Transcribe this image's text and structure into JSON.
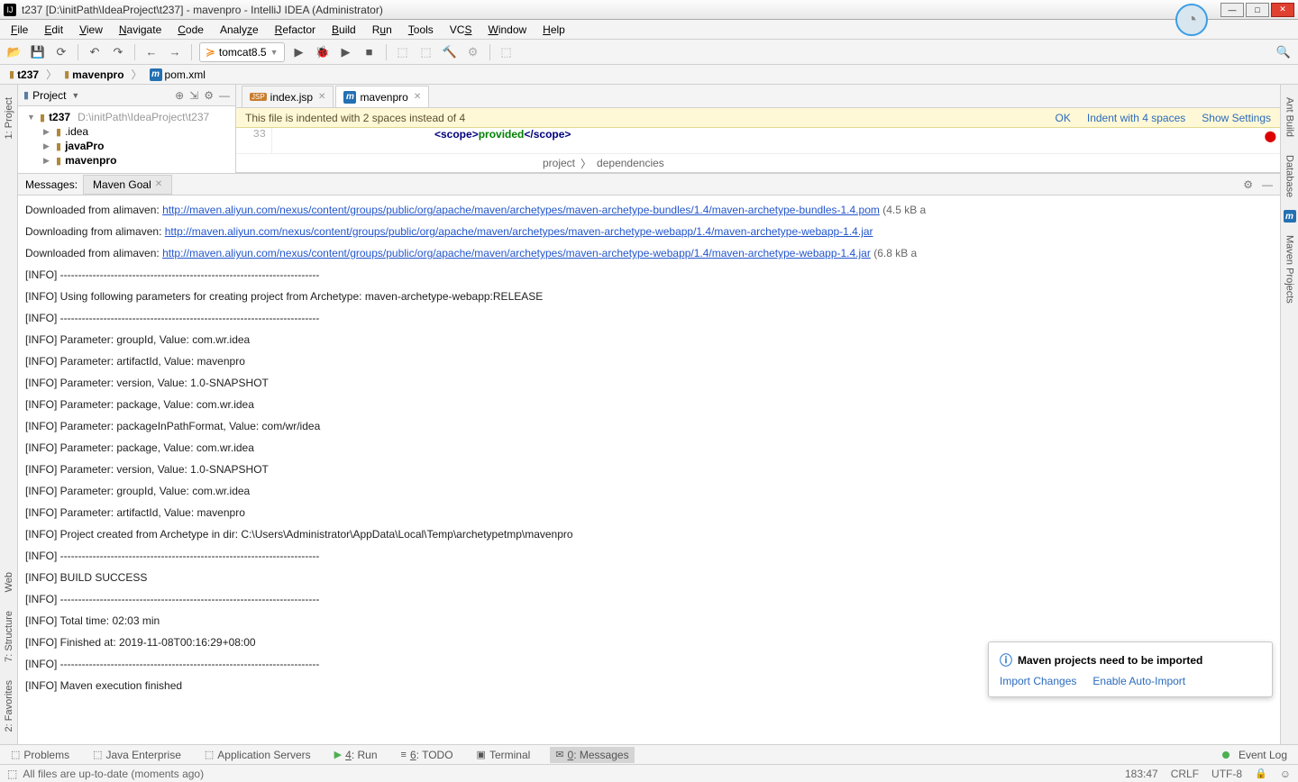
{
  "window": {
    "title": "t237 [D:\\initPath\\IdeaProject\\t237] - mavenpro - IntelliJ IDEA (Administrator)"
  },
  "menu": [
    "File",
    "Edit",
    "View",
    "Navigate",
    "Code",
    "Analyze",
    "Refactor",
    "Build",
    "Run",
    "Tools",
    "VCS",
    "Window",
    "Help"
  ],
  "toolbar": {
    "run_config": "tomcat8.5"
  },
  "breadcrumb": {
    "b1": "t237",
    "b2": "mavenpro",
    "b3": "pom.xml"
  },
  "project": {
    "panel_label": "Project",
    "root_name": "t237",
    "root_path": "D:\\initPath\\IdeaProject\\t237",
    "nodes": [
      ".idea",
      "javaPro",
      "mavenpro"
    ]
  },
  "editor_tabs": {
    "tab1": "index.jsp",
    "tab2": "mavenpro"
  },
  "notice": {
    "text": "This file is indented with 2 spaces instead of 4",
    "ok": "OK",
    "indent": "Indent with 4 spaces",
    "settings": "Show Settings"
  },
  "code": {
    "line_no": "33",
    "line_text_open": "<scope>",
    "line_text_mid": "provided",
    "line_text_close": "</scope>"
  },
  "editor_bc": {
    "p1": "project",
    "p2": "dependencies"
  },
  "messages": {
    "label": "Messages:",
    "tab": "Maven Goal",
    "lines": [
      {
        "prefix": "Downloaded from alimaven: ",
        "link": "http://maven.aliyun.com/nexus/content/groups/public/org/apache/maven/archetypes/maven-archetype-bundles/1.4/maven-archetype-bundles-1.4.pom",
        "suffix": " (4.5 kB a"
      },
      {
        "prefix": "Downloading from alimaven: ",
        "link": "http://maven.aliyun.com/nexus/content/groups/public/org/apache/maven/archetypes/maven-archetype-webapp/1.4/maven-archetype-webapp-1.4.jar",
        "suffix": ""
      },
      {
        "prefix": "Downloaded from alimaven: ",
        "link": "http://maven.aliyun.com/nexus/content/groups/public/org/apache/maven/archetypes/maven-archetype-webapp/1.4/maven-archetype-webapp-1.4.jar",
        "suffix": " (6.8 kB a"
      },
      {
        "text": "[INFO] ------------------------------------------------------------------------"
      },
      {
        "text": "[INFO] Using following parameters for creating project from Archetype: maven-archetype-webapp:RELEASE"
      },
      {
        "text": "[INFO] ------------------------------------------------------------------------"
      },
      {
        "text": "[INFO] Parameter: groupId, Value: com.wr.idea"
      },
      {
        "text": "[INFO] Parameter: artifactId, Value: mavenpro"
      },
      {
        "text": "[INFO] Parameter: version, Value: 1.0-SNAPSHOT"
      },
      {
        "text": "[INFO] Parameter: package, Value: com.wr.idea"
      },
      {
        "text": "[INFO] Parameter: packageInPathFormat, Value: com/wr/idea"
      },
      {
        "text": "[INFO] Parameter: package, Value: com.wr.idea"
      },
      {
        "text": "[INFO] Parameter: version, Value: 1.0-SNAPSHOT"
      },
      {
        "text": "[INFO] Parameter: groupId, Value: com.wr.idea"
      },
      {
        "text": "[INFO] Parameter: artifactId, Value: mavenpro"
      },
      {
        "text": "[INFO] Project created from Archetype in dir: C:\\Users\\Administrator\\AppData\\Local\\Temp\\archetypetmp\\mavenpro"
      },
      {
        "text": "[INFO] ------------------------------------------------------------------------"
      },
      {
        "text": "[INFO] BUILD SUCCESS"
      },
      {
        "text": "[INFO] ------------------------------------------------------------------------"
      },
      {
        "text": "[INFO] Total time:  02:03 min"
      },
      {
        "text": "[INFO] Finished at: 2019-11-08T00:16:29+08:00"
      },
      {
        "text": "[INFO] ------------------------------------------------------------------------"
      },
      {
        "text": "[INFO] Maven execution finished"
      }
    ]
  },
  "notification": {
    "title": "Maven projects need to be imported",
    "import": "Import Changes",
    "auto": "Enable Auto-Import"
  },
  "bottom_tabs": {
    "problems": "Problems",
    "java_ee": "Java Enterprise",
    "app_servers": "Application Servers",
    "run": "4: Run",
    "todo": "6: TODO",
    "terminal": "Terminal",
    "messages": "0: Messages",
    "event_log": "Event Log"
  },
  "status": {
    "left": "All files are up-to-date (moments ago)",
    "pos": "183:47",
    "eol": "CRLF",
    "enc": "UTF-8"
  },
  "side_tabs": {
    "left1": "1: Project",
    "left2": "7: Structure",
    "left3": "2: Favorites",
    "left4": "Web",
    "r1": "Ant Build",
    "r2": "Database",
    "r3": "Maven Projects",
    "r_icon": "m"
  }
}
